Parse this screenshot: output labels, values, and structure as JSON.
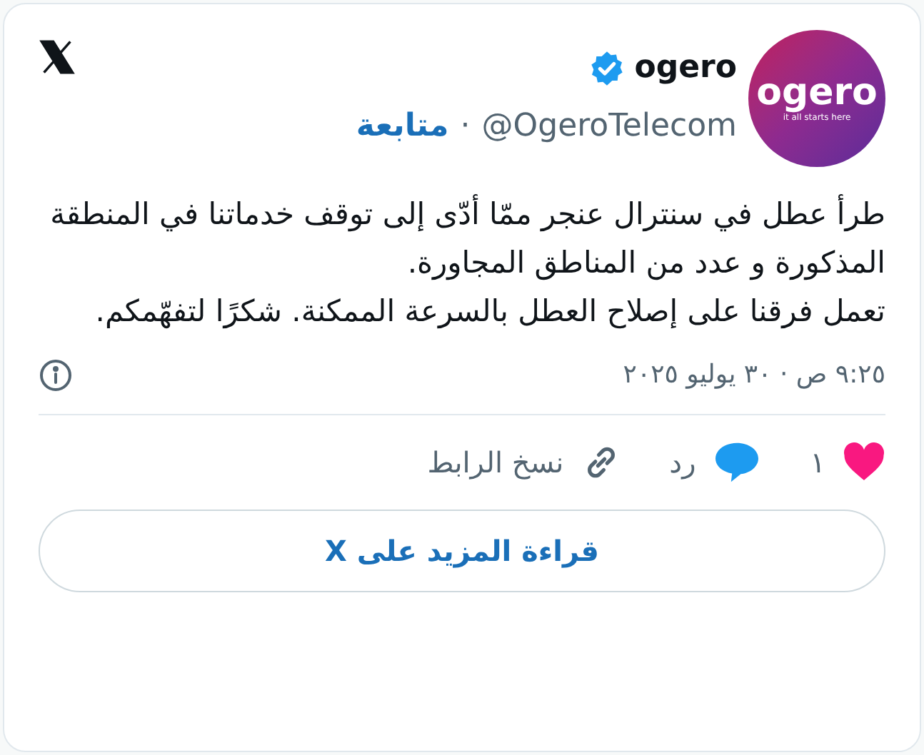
{
  "author": {
    "name": "ogero",
    "verified": true,
    "handle": "@OgeroTelecom",
    "separator": "·",
    "follow": "متابعة",
    "avatar_logo": "ogero",
    "avatar_tagline": "it all starts here"
  },
  "body": [
    "طرأ عطل في سنترال عنجر ممّا أدّى إلى توقف خدماتنا في المنطقة المذكورة و عدد من المناطق المجاورة.",
    "تعمل فرقنا على إصلاح العطل بالسرعة الممكنة. شكرًا لتفهّمكم."
  ],
  "timestamp": "٩:٢٥ ص · ٣٠ يوليو ٢٠٢٥",
  "actions": [
    {
      "kind": "like",
      "label": "١"
    },
    {
      "kind": "reply",
      "label": "رد"
    },
    {
      "kind": "copy",
      "label": "نسخ الرابط"
    }
  ],
  "read_more": "قراءة المزيد على X"
}
